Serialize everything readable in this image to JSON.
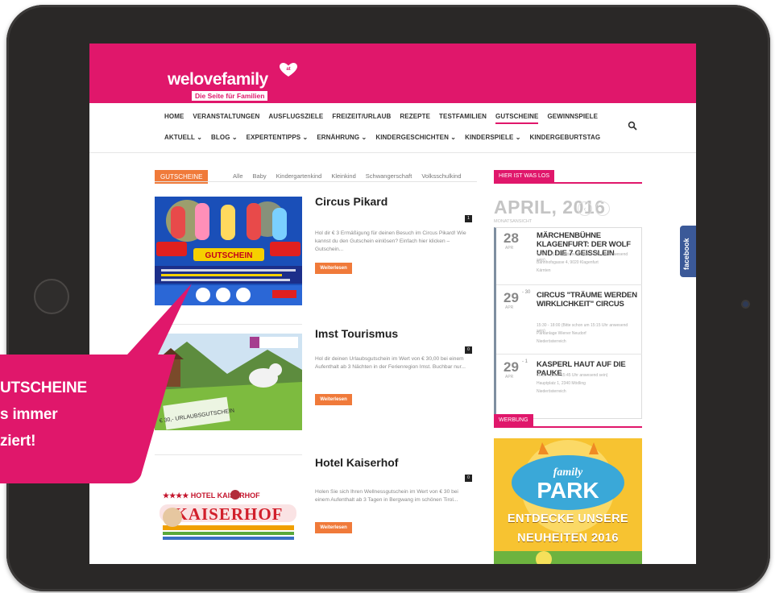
{
  "site": {
    "logo_text": "welovefamily",
    "logo_badge": "at",
    "tagline": "Die Seite für Familien"
  },
  "nav": {
    "row1": [
      "HOME",
      "VERANSTALTUNGEN",
      "AUSFLUGSZIELE",
      "FREIZEIT/URLAUB",
      "REZEPTE",
      "TESTFAMILIEN",
      "GUTSCHEINE",
      "GEWINNSPIELE"
    ],
    "row2": [
      "AKTUELL ⌄",
      "BLOG ⌄",
      "EXPERTENTIPPS ⌄",
      "ERNÄHRUNG ⌄",
      "KINDERGESCHICHTEN ⌄",
      "KINDERSPIELE ⌄",
      "KINDERGEBURTSTAG"
    ],
    "active": "GUTSCHEINE"
  },
  "section": {
    "label": "GUTSCHEINE",
    "filters": [
      "Alle",
      "Baby",
      "Kindergartenkind",
      "Kleinkind",
      "Schwangerschaft",
      "Volksschulkind"
    ]
  },
  "items": [
    {
      "title": "Circus Pikard",
      "count": "1",
      "text": "Hol dir € 3 Ermäßigung für deinen Besuch im Circus Pikard! Wie kannst du den Gutschein einlösen? Einfach hier klicken – Gutschein...",
      "button": "Weiterlesen",
      "image_caption": "GUTSCHEIN"
    },
    {
      "title": "Imst Tourismus",
      "count": "0",
      "text": "Hol dir deinen Urlaubsgutschein im Wert von € 30,00 bei einem Aufenthalt ab 3 Nächten in der Ferienregion Imst. Buchbar nur...",
      "button": "Weiterlesen",
      "image_caption": "€ 30,- URLAUBSGUTSCHEIN"
    },
    {
      "title": "Hotel Kaiserhof",
      "count": "0",
      "text": "Holen Sie sich Ihren Wellnessgutschein im Wert von € 30 bei einem Aufenthalt ab 3 Tagen in Bergwang im schönen Tirol...",
      "button": "Weiterlesen",
      "image_caption": "★★★★ HOTEL KAISERHOF"
    }
  ],
  "sidebar": {
    "events_label": "HIER IST WAS LOS",
    "month": "APRIL, 2016",
    "month_sub": "MONATSANSICHT",
    "events": [
      {
        "day": "28",
        "mon": "APR",
        "sup": "",
        "title": "MÄRCHENBÜHNE KLAGENFURT: DER WOLF UND DIE 7 GEISSLEIN",
        "meta1": "14:00 - 15:15 (Bitte schon um 13:45 Uhr anwesend sein)",
        "meta2": "Bahnhofsgasse 4, 9020 Klagenfurt",
        "meta3": "Kärnten"
      },
      {
        "day": "29",
        "mon": "APR",
        "sup": "- 30",
        "title": "CIRCUS \"TRÄUME WERDEN WIRKLICHKEIT\" CIRCUS",
        "meta1": "15:30 - 18:00 (Bitte schon um 15:15 Uhr anwesend sein)",
        "meta2": "Parkanlage Wiener Neudorf",
        "meta3": "Niederösterreich"
      },
      {
        "day": "29",
        "mon": "APR",
        "sup": "- 1",
        "title": "KASPERL HAUT AUF DIE PAUKE",
        "meta1": "16:00 - (Bitte 15:45 Uhr anwesend sein)",
        "meta2": "Hauptplatz 1, 2340 Mödling",
        "meta3": "Niederösterreich"
      }
    ],
    "ad_label": "WERBUNG",
    "ad_brand": "family PARK",
    "ad_line1": "ENTDECKE UNSERE",
    "ad_line2": "NEUHEITEN 2016"
  },
  "facebook_tab": "facebook",
  "callout": {
    "line1": "UTSCHEINE",
    "line2": "s immer",
    "line3": "ziert!"
  },
  "colors": {
    "brand_pink": "#e0176b",
    "accent_orange": "#f07a3a",
    "facebook_blue": "#3b5998",
    "tablet_bezel": "#2a2827"
  }
}
